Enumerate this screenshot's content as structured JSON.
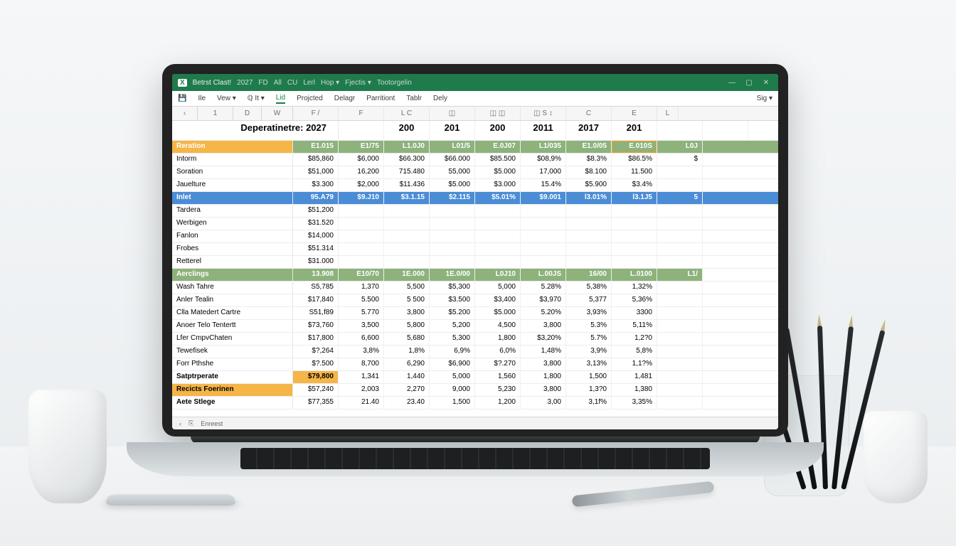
{
  "app": {
    "icon_label": "X",
    "title_parts": [
      "Betrst Clast!",
      "2027",
      "FD",
      "All",
      "CU",
      "Lerl",
      "Hop ▾",
      "Fjectis ▾",
      "Tootorgelin"
    ]
  },
  "window": {
    "minimize": "—",
    "restore": "▢",
    "close": "✕"
  },
  "ribbon": {
    "save_icon": "💾",
    "items": [
      "Ile",
      "Vew ▾",
      "ℚ  It ▾",
      "Lid",
      "Projcted",
      "Delagr",
      "Parritiont",
      "Tablr",
      "Dely"
    ],
    "right": "Sig ▾",
    "selected_index": 3
  },
  "colnav": {
    "back": "‹",
    "box": "1",
    "d": "D",
    "fx": "W",
    "letters": [
      "F /",
      "F",
      "L  C",
      "◫",
      "◫ ◫",
      "◫  S ↕",
      "C",
      "E",
      "L"
    ]
  },
  "sheet_title": "Deperatinetre: 2027",
  "year_headers": [
    "",
    "200",
    "201",
    "200",
    "2011",
    "2017",
    "201"
  ],
  "section1": {
    "header": {
      "label": "Reration",
      "cells": [
        "E1.015",
        "E1/75",
        "L1.0J0",
        "L01/5",
        "E.0J07",
        "L1/035",
        "E1.0/05",
        "E.010S",
        "L0J"
      ]
    },
    "rows": [
      {
        "label": "Intorm",
        "cells": [
          "$85,860",
          "$6,000",
          "$66.300",
          "$66.000",
          "$85.500",
          "$08,9%",
          "$8.3%",
          "$86.5%",
          "$"
        ]
      },
      {
        "label": "Soration",
        "cells": [
          "$51,000",
          "16,200",
          "715.480",
          "55,000",
          "$5.000",
          "17,000",
          "$8.100",
          "11.500",
          ""
        ]
      },
      {
        "label": "Jauelture",
        "cells": [
          "$3.300",
          "$2,000",
          "$11.436",
          "$5.000",
          "$3.000",
          "15.4%",
          "$5.900",
          "$3.4%",
          ""
        ]
      }
    ],
    "selected": {
      "label": "Inlet",
      "cells": [
        "95.A79",
        "$9.J10",
        "$3.1.15",
        "$2.115",
        "$5.01%",
        "$9.001",
        "l3.01%",
        "l3.1J5",
        "5"
      ]
    },
    "subrows": [
      {
        "label": "Tardera",
        "first": "$51,200"
      },
      {
        "label": "Werbigen",
        "first": "$31.520"
      },
      {
        "label": "Fanlon",
        "first": "$14,000"
      },
      {
        "label": "Frobes",
        "first": "$51.314"
      },
      {
        "label": "Retterel",
        "first": "$31.000"
      }
    ]
  },
  "section2": {
    "header": {
      "label": "Aerclings",
      "cells": [
        "13.908",
        "E10/70",
        "1E.000",
        "1E.0/00",
        "L0J10",
        "L.00JS",
        "16/00",
        "L.0100",
        "L1/"
      ]
    },
    "rows": [
      {
        "label": "Wash Tahre",
        "cells": [
          "S5,785",
          "1,370",
          "5,500",
          "$5,300",
          "5,000",
          "5.28%",
          "5,38%",
          "1,32%",
          ""
        ]
      },
      {
        "label": "Anler Tealin",
        "cells": [
          "$17,840",
          "5.500",
          "5 500",
          "$3.500",
          "$3,400",
          "$3,970",
          "5,377",
          "5,36%",
          ""
        ]
      },
      {
        "label": "Clla Matedert Cartre",
        "cells": [
          "S51,f89",
          "5.770",
          "3,800",
          "$5.200",
          "$5.000",
          "5.20%",
          "3,93%",
          "3300",
          ""
        ]
      },
      {
        "label": "Anoer Telo Tentertt",
        "cells": [
          "$73,760",
          "3,500",
          "5,800",
          "5,200",
          "4,500",
          "3,800",
          "5.3%",
          "5,11%",
          ""
        ]
      },
      {
        "label": "Lfer CmpvChaten",
        "cells": [
          "$17,800",
          "6,600",
          "5,680",
          "5,300",
          "1,800",
          "$3,20%",
          "5.7%",
          "1,2?0",
          ""
        ]
      },
      {
        "label": "Tewefisek",
        "cells": [
          "$?,264",
          "3,8%",
          "1,8%",
          "6,9%",
          "6,0%",
          "1,48%",
          "3,9%",
          "5,8%",
          ""
        ]
      },
      {
        "label": "Forr Pthshe",
        "cells": [
          "$?.500",
          "8,700",
          "6,290",
          "$6,900",
          "$?.270",
          "3,800",
          "3,13%",
          "1,1?%",
          ""
        ]
      }
    ],
    "subtotal": {
      "label": "Satptrperate",
      "cells": [
        "$79,800",
        "1,341",
        "1,440",
        "5,000",
        "1,560",
        "1,800",
        "1,500",
        "1,481",
        ""
      ]
    },
    "footer1": {
      "label": "Recicts Foerinen",
      "cells": [
        "$57,240",
        "2,003",
        "2,270",
        "9,000",
        "5,230",
        "3,800",
        "1,3?0",
        "1,380",
        ""
      ]
    },
    "footer2": {
      "label": "Aete Stlege",
      "cells": [
        "$77,355",
        "21.40",
        "23.40",
        "1,500",
        "1,200",
        "3,00",
        "3,1f%",
        "3,35%",
        ""
      ]
    }
  },
  "status": {
    "sheet_icon": "⎘",
    "ready": "Enreest"
  }
}
